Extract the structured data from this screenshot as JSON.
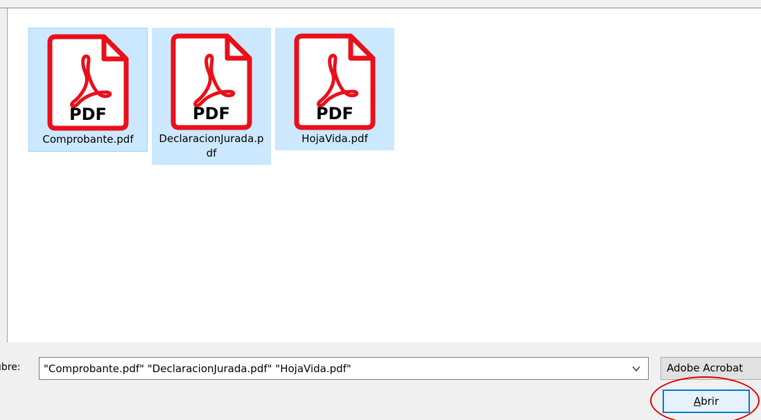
{
  "files": [
    {
      "name": "Comprobante.pdf",
      "icon": "pdf-file-icon",
      "icon_label": "PDF",
      "selected": true,
      "focused": true
    },
    {
      "name": "DeclaracionJurada.pdf",
      "icon": "pdf-file-icon",
      "icon_label": "PDF",
      "selected": true,
      "focused": false
    },
    {
      "name": "HojaVida.pdf",
      "icon": "pdf-file-icon",
      "icon_label": "PDF",
      "selected": true,
      "focused": false
    }
  ],
  "filename_bar": {
    "label": "ıbre:",
    "value": "\"Comprobante.pdf\" \"DeclaracionJurada.pdf\" \"HojaVida.pdf\"",
    "dropdown_icon": "chevron-down-icon"
  },
  "file_type": {
    "selected": "Adobe Acrobat"
  },
  "actions": {
    "open_accel": "A",
    "open_rest": "brir"
  },
  "colors": {
    "selection_bg": "#cce8ff",
    "selection_border": "#99d1ff",
    "pdf_red": "#e8101a",
    "accent": "#0078d7",
    "annotation": "#e00000"
  }
}
